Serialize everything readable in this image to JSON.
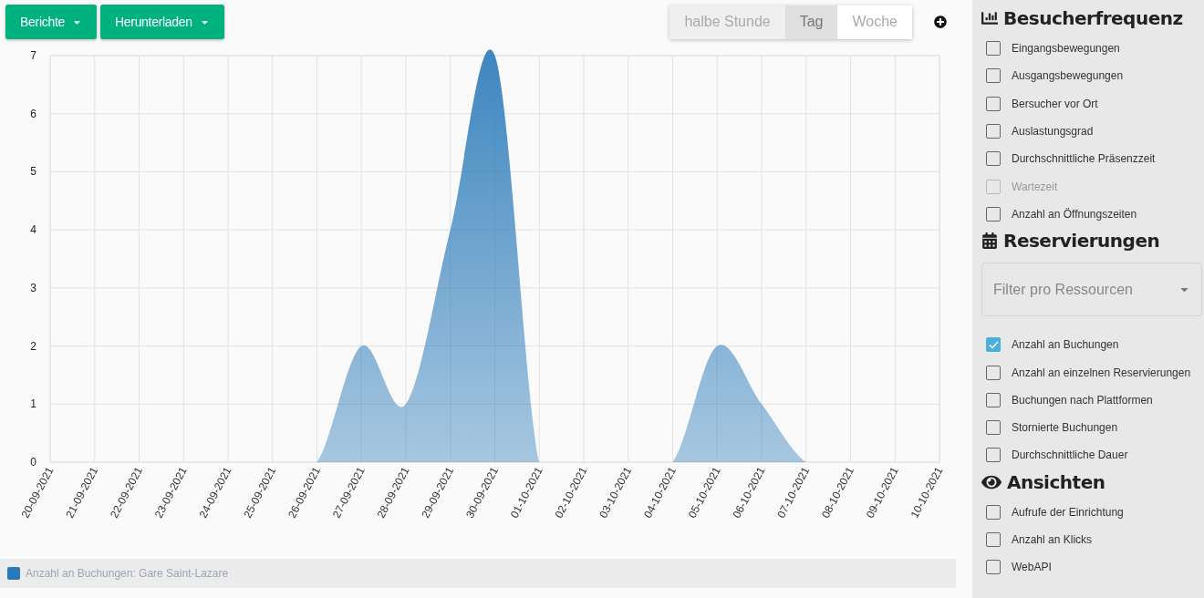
{
  "toolbar": {
    "menus": [
      {
        "label": "Berichte"
      },
      {
        "label": "Herunterladen"
      }
    ],
    "granularity": [
      {
        "label": "halbe Stunde",
        "selected": false,
        "disabled": true
      },
      {
        "label": "Tag",
        "selected": true,
        "disabled": false
      },
      {
        "label": "Woche",
        "selected": false,
        "disabled": false
      }
    ]
  },
  "chart": {
    "chart_data": {
      "type": "area",
      "categories": [
        "20-09-2021",
        "21-09-2021",
        "22-09-2021",
        "23-09-2021",
        "24-09-2021",
        "25-09-2021",
        "26-09-2021",
        "27-09-2021",
        "28-09-2021",
        "29-09-2021",
        "30-09-2021",
        "01-10-2021",
        "02-10-2021",
        "03-10-2021",
        "04-10-2021",
        "05-10-2021",
        "06-10-2021",
        "07-10-2021",
        "08-10-2021",
        "09-10-2021",
        "10-10-2021"
      ],
      "series": [
        {
          "name": "Anzahl an Buchungen: Gare Saint-Lazare",
          "color": "#2a7ab9",
          "values": [
            0,
            0,
            0,
            0,
            0,
            0,
            0,
            2,
            1,
            4,
            7,
            0,
            0,
            0,
            0,
            2,
            1,
            0,
            0,
            0,
            0
          ]
        }
      ],
      "ylim": [
        0,
        7
      ],
      "grid": true,
      "yticks": [
        0,
        1,
        2,
        3,
        4,
        5,
        6,
        7
      ]
    }
  },
  "sidebar": {
    "sections": [
      {
        "kind": "chart",
        "title": "Besucherfrequenz",
        "items": [
          {
            "label": "Eingangsbewegungen",
            "checked": false,
            "disabled": false
          },
          {
            "label": "Ausgangsbewegungen",
            "checked": false,
            "disabled": false
          },
          {
            "label": "Bersucher vor Ort",
            "checked": false,
            "disabled": false
          },
          {
            "label": "Auslastungsgrad",
            "checked": false,
            "disabled": false
          },
          {
            "label": "Durchschnittliche Präsenzzeit",
            "checked": false,
            "disabled": false
          },
          {
            "label": "Wartezeit",
            "checked": false,
            "disabled": true
          },
          {
            "label": "Anzahl an Öffnungszeiten",
            "checked": false,
            "disabled": false
          }
        ]
      },
      {
        "kind": "calendar",
        "title": "Reservierungen",
        "select": {
          "placeholder": "Filter pro Ressourcen"
        },
        "items": [
          {
            "label": "Anzahl an Buchungen",
            "checked": true,
            "disabled": false
          },
          {
            "label": "Anzahl an einzelnen Reservierungen",
            "checked": false,
            "disabled": false
          },
          {
            "label": "Buchungen nach Plattformen",
            "checked": false,
            "disabled": false
          },
          {
            "label": "Stornierte Buchungen",
            "checked": false,
            "disabled": false
          },
          {
            "label": "Durchschnittliche Dauer",
            "checked": false,
            "disabled": false
          }
        ]
      },
      {
        "kind": "eye",
        "title": "Ansichten",
        "items": [
          {
            "label": "Aufrufe der Einrichtung",
            "checked": false,
            "disabled": false
          },
          {
            "label": "Anzahl an Klicks",
            "checked": false,
            "disabled": false
          },
          {
            "label": "WebAPI",
            "checked": false,
            "disabled": false
          }
        ]
      }
    ]
  }
}
